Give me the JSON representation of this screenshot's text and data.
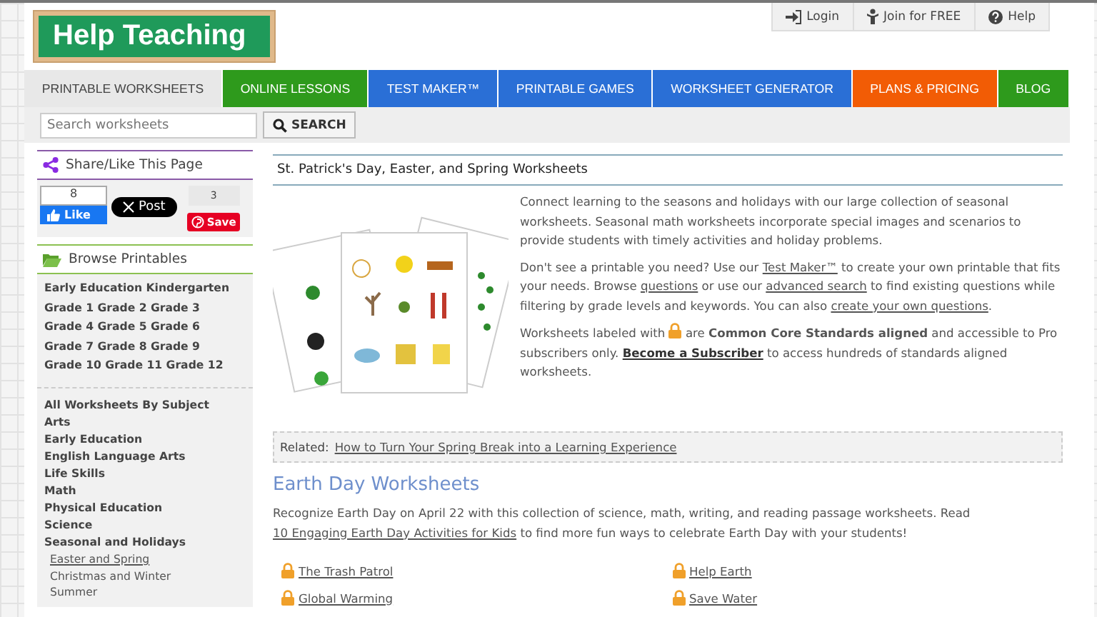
{
  "logo": "Help Teaching",
  "top_links": [
    {
      "label": "Login"
    },
    {
      "label": "Join for FREE"
    },
    {
      "label": "Help"
    }
  ],
  "nav": [
    {
      "label": "PRINTABLE WORKSHEETS",
      "selected": true,
      "color": "#e8e8e8"
    },
    {
      "label": "ONLINE LESSONS",
      "selected": false,
      "color": "#2e9a1c"
    },
    {
      "label": "TEST MAKER™",
      "selected": false,
      "color": "#2a6fd6"
    },
    {
      "label": "PRINTABLE GAMES",
      "selected": false,
      "color": "#2a6fd6"
    },
    {
      "label": "WORKSHEET GENERATOR",
      "selected": false,
      "color": "#2a6fd6"
    },
    {
      "label": "PLANS & PRICING",
      "selected": false,
      "color": "#f25c05"
    },
    {
      "label": "BLOG",
      "selected": false,
      "color": "#2e9a1c"
    }
  ],
  "search": {
    "placeholder": "Search worksheets",
    "button": "SEARCH"
  },
  "share": {
    "title": "Share/Like This Page",
    "like_count": "8",
    "like": "Like",
    "post": "Post",
    "save_count": "3",
    "save": "Save"
  },
  "browse": {
    "title": "Browse Printables",
    "grades": [
      "Early Education Kindergarten",
      "Grade 1 Grade 2 Grade 3",
      "Grade 4 Grade 5 Grade 6",
      "Grade 7 Grade 8 Grade 9",
      "Grade 10 Grade 11 Grade 12"
    ],
    "subjects": [
      {
        "label": "All Worksheets By Subject"
      },
      {
        "label": "Arts"
      },
      {
        "label": "Early Education"
      },
      {
        "label": "English Language Arts"
      },
      {
        "label": "Life Skills"
      },
      {
        "label": "Math"
      },
      {
        "label": "Physical Education"
      },
      {
        "label": "Science"
      },
      {
        "label": "Seasonal and Holidays",
        "children": [
          {
            "label": "Easter and Spring",
            "selected": true
          },
          {
            "label": "Christmas and Winter",
            "selected": false
          },
          {
            "label": "Summer",
            "selected": false
          }
        ]
      }
    ]
  },
  "page_title": "St. Patrick's Day, Easter, and Spring Worksheets",
  "intro": [
    [
      {
        "kind": "text",
        "text": "Connect learning to the seasons and holidays with our large collection of seasonal worksheets. Seasonal math worksheets incorporate special images and scenarios to provide students with timely activities and holiday problems."
      }
    ],
    [
      {
        "kind": "text",
        "text": "Don't see a printable you need? Use our "
      },
      {
        "kind": "link",
        "text": "Test Maker™"
      },
      {
        "kind": "text",
        "text": " to create your own printable that fits your needs. Browse "
      },
      {
        "kind": "link",
        "text": "questions"
      },
      {
        "kind": "text",
        "text": " or use our "
      },
      {
        "kind": "link",
        "text": "advanced search"
      },
      {
        "kind": "text",
        "text": " to find existing questions while filtering by grade levels and keywords. You can also "
      },
      {
        "kind": "link",
        "text": "create your own questions"
      },
      {
        "kind": "text",
        "text": "."
      }
    ],
    [
      {
        "kind": "text",
        "text": "Worksheets labeled with "
      },
      {
        "kind": "lock"
      },
      {
        "kind": "text",
        "text": " are "
      },
      {
        "kind": "bold",
        "text": "Common Core Standards aligned"
      },
      {
        "kind": "text",
        "text": " and accessible to Pro subscribers only. "
      },
      {
        "kind": "boldlink",
        "text": "Become a Subscriber"
      },
      {
        "kind": "text",
        "text": " to access hundreds of standards aligned worksheets."
      }
    ]
  ],
  "related": {
    "label": "Related:",
    "link": "How to Turn Your Spring Break into a Learning Experience"
  },
  "section": {
    "title": "Earth Day Worksheets",
    "text": [
      {
        "kind": "text",
        "text": "Recognize Earth Day on April 22 with this collection of science, math, writing, and reading passage worksheets. Read "
      },
      {
        "kind": "link",
        "text": "10 Engaging Earth Day Activities for Kids"
      },
      {
        "kind": "text",
        "text": " to find more fun ways to celebrate Earth Day with your students!"
      }
    ],
    "worksheets": [
      {
        "label": "The Trash Patrol",
        "locked": true
      },
      {
        "label": "Help Earth",
        "locked": true
      },
      {
        "label": "Global Warming",
        "locked": true
      },
      {
        "label": "Save Water",
        "locked": true
      }
    ]
  }
}
